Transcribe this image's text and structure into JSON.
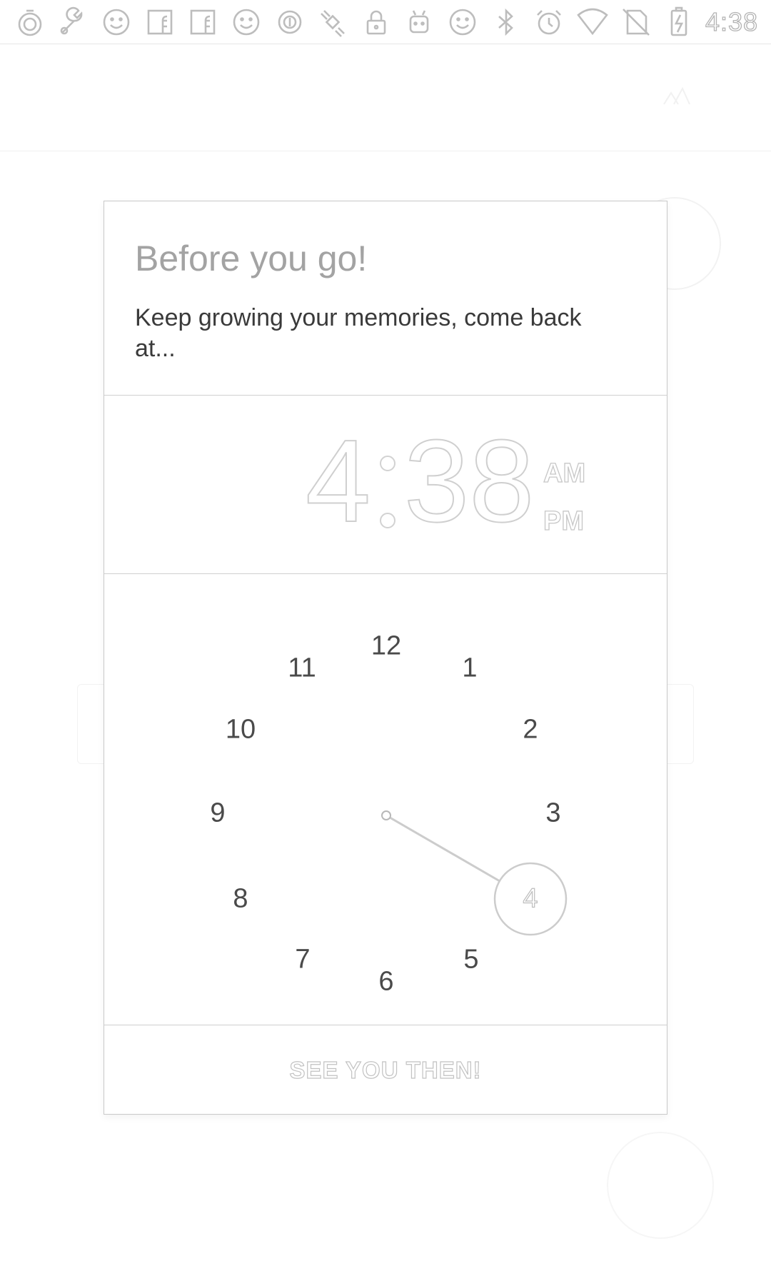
{
  "status_bar": {
    "icons": [
      "stopwatch-icon",
      "wrench-icon",
      "smiley-icon",
      "facebook-icon",
      "facebook-icon",
      "smiley-icon",
      "record-icon",
      "satellite-icon",
      "lock-icon",
      "android-icon",
      "smiley-icon",
      "bluetooth-icon",
      "alarm-icon",
      "wifi-icon",
      "no-sim-icon",
      "battery-charging-icon"
    ],
    "time": "4:38"
  },
  "dialog": {
    "title": "Before you go!",
    "message": "Keep growing your memories, come back at...",
    "time_display": {
      "hour": "4",
      "minutes": "38",
      "am": "AM",
      "pm": "PM"
    },
    "clock": {
      "numbers": [
        "12",
        "1",
        "2",
        "3",
        "4",
        "5",
        "6",
        "7",
        "8",
        "9",
        "10",
        "11"
      ],
      "selected_hour": "4"
    },
    "action_button": "SEE YOU THEN!"
  }
}
